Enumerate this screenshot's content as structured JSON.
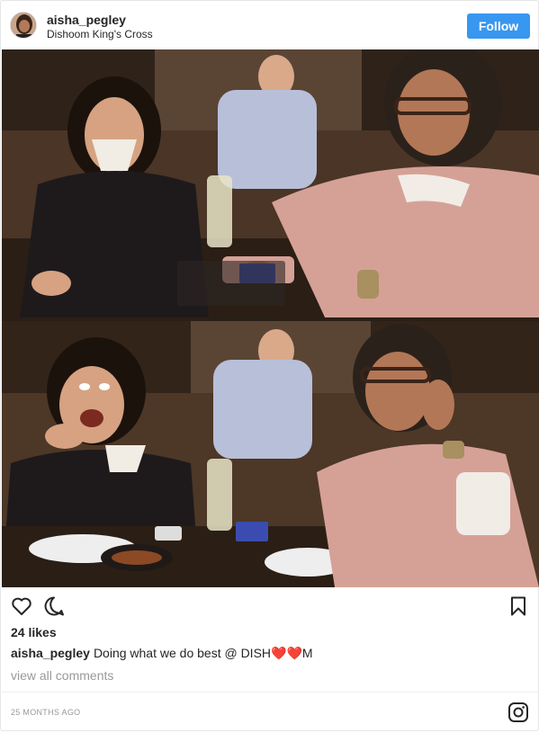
{
  "header": {
    "username": "aisha_pegley",
    "location": "Dishoom King's Cross",
    "follow_label": "Follow"
  },
  "post": {
    "likes": "24 likes",
    "caption_user": "aisha_pegley",
    "caption_text": "Doing what we do best @ DISH❤️❤️M",
    "view_comments": "view all comments",
    "timestamp": "25 MONTHS AGO"
  },
  "icons": {
    "like": "heart-icon",
    "comment": "comment-icon",
    "save": "bookmark-icon",
    "brand": "instagram-icon"
  },
  "colors": {
    "follow_button": "#3897f0",
    "muted_text": "#999999",
    "text": "#262626"
  }
}
